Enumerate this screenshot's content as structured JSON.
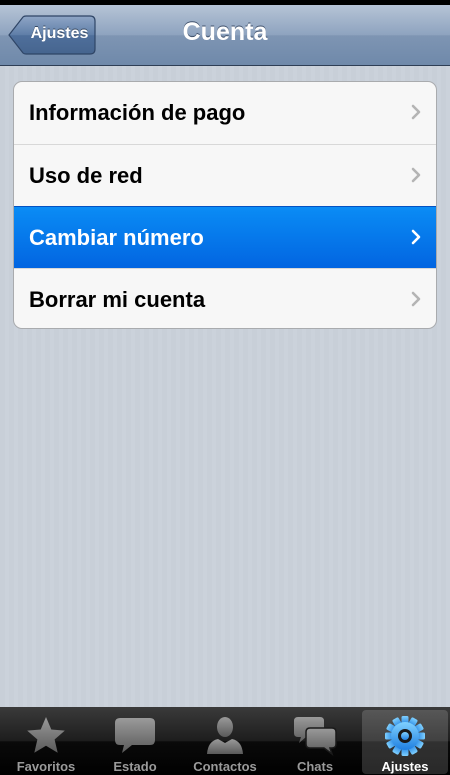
{
  "navbar": {
    "title": "Cuenta",
    "back_label": "Ajustes"
  },
  "settings": {
    "items": [
      {
        "label": "Información de pago",
        "selected": false
      },
      {
        "label": "Uso de red",
        "selected": false
      },
      {
        "label": "Cambiar número",
        "selected": true
      },
      {
        "label": "Borrar mi cuenta",
        "selected": false
      }
    ]
  },
  "tabbar": {
    "tabs": [
      {
        "label": "Favoritos",
        "icon": "star-icon"
      },
      {
        "label": "Estado",
        "icon": "speech-bubble-icon"
      },
      {
        "label": "Contactos",
        "icon": "person-icon"
      },
      {
        "label": "Chats",
        "icon": "chat-bubbles-icon"
      },
      {
        "label": "Ajustes",
        "icon": "gear-icon",
        "active": true
      }
    ]
  },
  "colors": {
    "selected_row": "#0a7cf0",
    "navbar": "#8ea3bf",
    "background": "#c8cfd8"
  }
}
